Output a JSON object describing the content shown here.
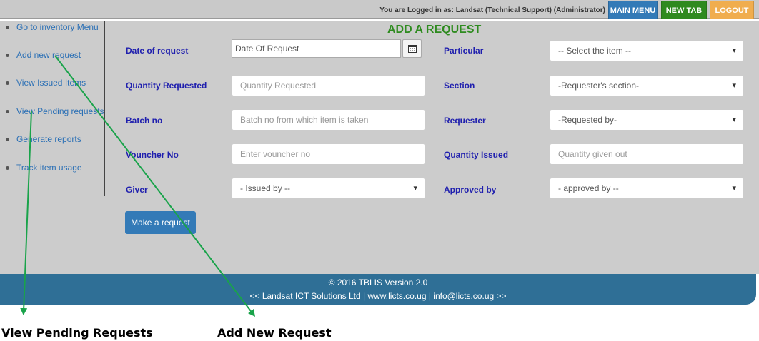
{
  "topbar": {
    "logged_in_text": "You are Logged in as: Landsat (Technical Support) (Administrator)",
    "main_menu": "MAIN MENU",
    "new_tab": "NEW TAB",
    "logout": "LOGOUT"
  },
  "sidebar": {
    "items": [
      {
        "label": "Go to inventory Menu"
      },
      {
        "label": "Add new request"
      },
      {
        "label": "View Issued Items"
      },
      {
        "label": "View Pending requests"
      },
      {
        "label": "Generate reports"
      },
      {
        "label": "Track item usage"
      }
    ]
  },
  "form": {
    "title": "ADD A REQUEST",
    "date_label": "Date of request",
    "date_value": "Date Of Request",
    "particular_label": "Particular",
    "particular_select": "-- Select the item --",
    "quantity_label": "Quantity Requested",
    "quantity_placeholder": "Quantity Requested",
    "section_label": "Section",
    "section_select": "-Requester's section-",
    "batch_label": "Batch no",
    "batch_placeholder": "Batch no from which item is taken",
    "requester_label": "Requester",
    "requester_select": "-Requested by-",
    "voucher_label": "Vouncher No",
    "voucher_placeholder": "Enter vouncher no",
    "qty_issued_label": "Quantity Issued",
    "qty_issued_placeholder": "Quantity given out",
    "giver_label": "Giver",
    "giver_select": "- Issued by --",
    "approved_label": "Approved by",
    "approved_select": "- approved by --",
    "submit": "Make a request"
  },
  "footer": {
    "line1": "© 2016 TBLIS Version 2.0",
    "line2": "<< Landsat ICT Solutions Ltd | www.licts.co.ug | info@licts.co.ug >>"
  },
  "annotations": {
    "left": "View Pending Requests",
    "right": "Add New Request",
    "arrow_color": "#19a34a"
  }
}
